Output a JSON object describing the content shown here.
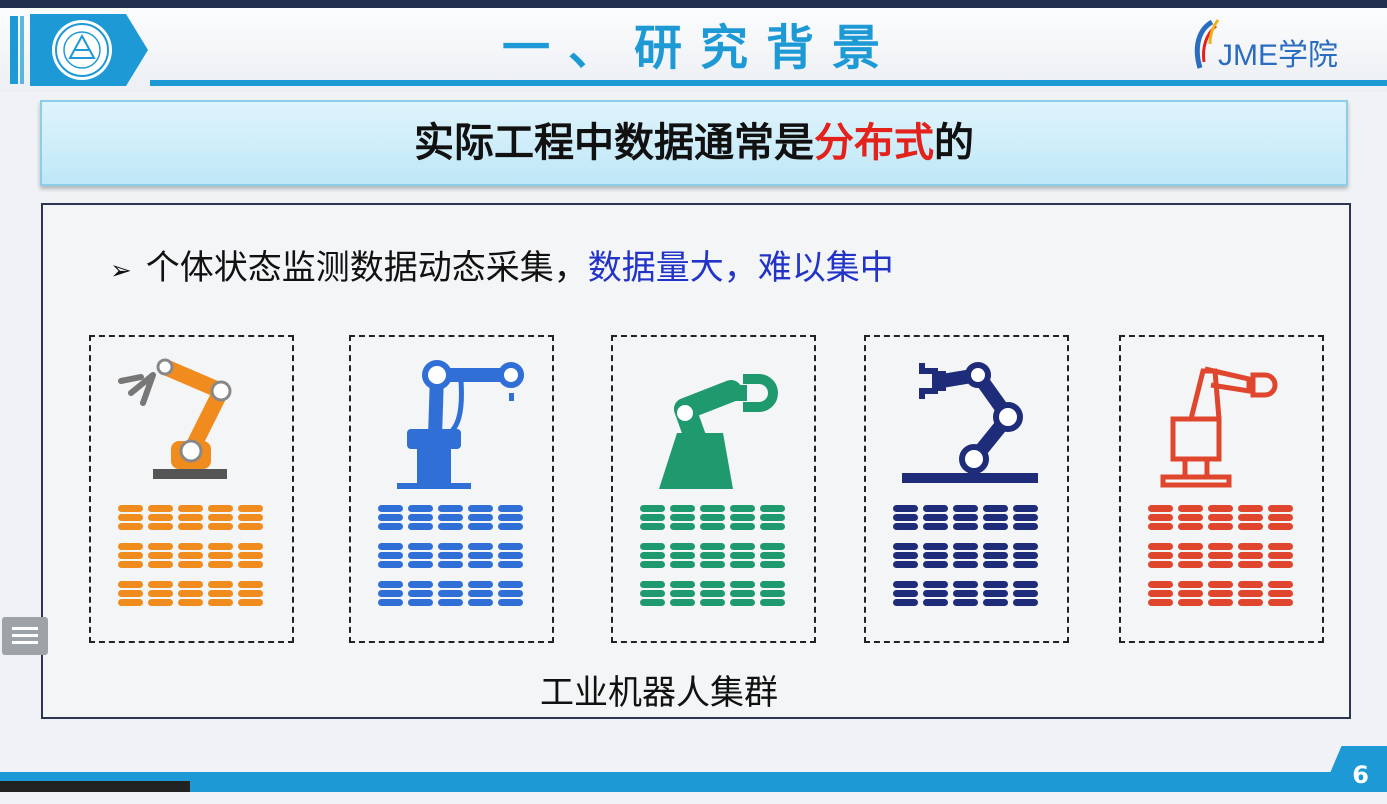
{
  "slide": {
    "title": "一、研究背景",
    "brand": "JME学院",
    "subtitle_pre": "实际工程中数据通常是",
    "subtitle_highlight": "分布式",
    "subtitle_post": "的",
    "bullet_marker": "➢",
    "bullet_text": "个体状态监测数据动态采集，",
    "bullet_blue1": "数据量大，",
    "bullet_blue2": "难以集中",
    "caption": "工业机器人集群",
    "page_number": "6"
  },
  "robots": [
    {
      "name": "orange-robot-arm-icon",
      "color": "#f08c1e"
    },
    {
      "name": "blue-robot-arm-icon",
      "color": "#2f6fd6"
    },
    {
      "name": "green-robot-arm-icon",
      "color": "#1e9a6e"
    },
    {
      "name": "navy-robot-arm-icon",
      "color": "#1f2c7a"
    },
    {
      "name": "red-robot-arm-icon",
      "color": "#e0462d"
    }
  ],
  "colors": {
    "accent": "#1d9ad6",
    "highlight": "#e3221c",
    "bullet_blue": "#2233c7"
  }
}
